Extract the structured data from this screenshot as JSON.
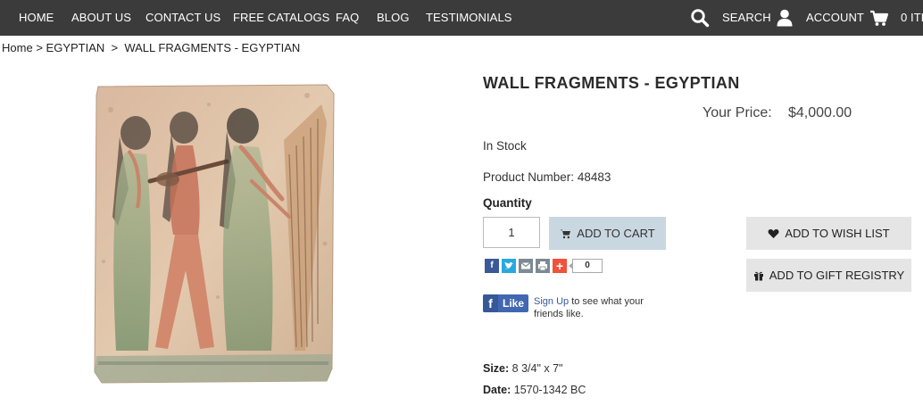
{
  "nav": {
    "items": [
      "HOME",
      "ABOUT US",
      "CONTACT US",
      "FREE CATALOGS",
      "FAQ",
      "BLOG",
      "TESTIMONIALS"
    ],
    "search_label": "SEARCH",
    "account_label": "ACCOUNT",
    "cart_label": "0 ITE"
  },
  "breadcrumb": {
    "home": "Home",
    "sep1": ">",
    "category": "EGYPTIAN",
    "sep2": ">",
    "current": "WALL FRAGMENTS - EGYPTIAN"
  },
  "product": {
    "title": "WALL FRAGMENTS - EGYPTIAN",
    "price_label": "Your Price:",
    "price": "$4,000.00",
    "stock": "In Stock",
    "number_label": "Product Number:",
    "number": "48483",
    "quantity_label": "Quantity",
    "quantity_value": "1",
    "size_label": "Size:",
    "size": "8 3/4\" x 7\"",
    "date_label": "Date:",
    "date": "1570-1342 BC"
  },
  "actions": {
    "add_to_cart": "ADD TO CART",
    "wish_list": "ADD TO WISH LIST",
    "gift_registry": "ADD TO GIFT REGISTRY"
  },
  "share": {
    "icons": [
      "facebook-icon",
      "twitter-icon",
      "email-icon",
      "print-icon",
      "plus-icon"
    ],
    "colors": {
      "facebook": "#3b5998",
      "twitter": "#2aa9e0",
      "email": "#7d8a93",
      "print": "#7d8a93",
      "plus": "#f0523b"
    },
    "count": "0"
  },
  "facebook": {
    "like_label": "Like",
    "signup": "Sign Up",
    "text": " to see what your friends like."
  },
  "colors": {
    "nav_bg": "#3b3b3b",
    "add_cart_bg": "#c9d7e1",
    "side_btn_bg": "#e5e5e5"
  }
}
